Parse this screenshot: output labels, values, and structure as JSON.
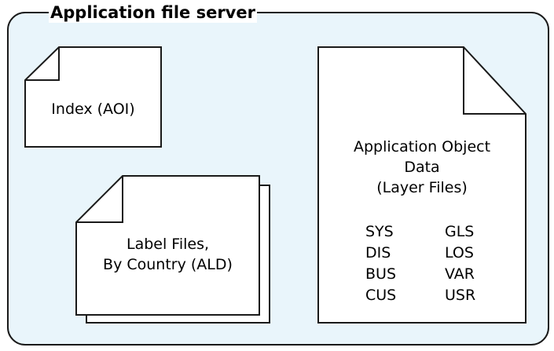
{
  "container": {
    "title": "Application file server",
    "fill": "#e9f5fb",
    "stroke": "#1a1a1a"
  },
  "documents": {
    "index": {
      "label": "Index (AOI)"
    },
    "label_files": {
      "lines": [
        "Label Files,",
        "By Country (ALD)"
      ]
    },
    "app_object_data": {
      "lines": [
        "Application Object",
        "Data",
        "(Layer Files)"
      ],
      "layers_left": [
        "SYS",
        "DIS",
        "BUS",
        "CUS"
      ],
      "layers_right": [
        "GLS",
        "LOS",
        "VAR",
        "USR"
      ]
    }
  }
}
